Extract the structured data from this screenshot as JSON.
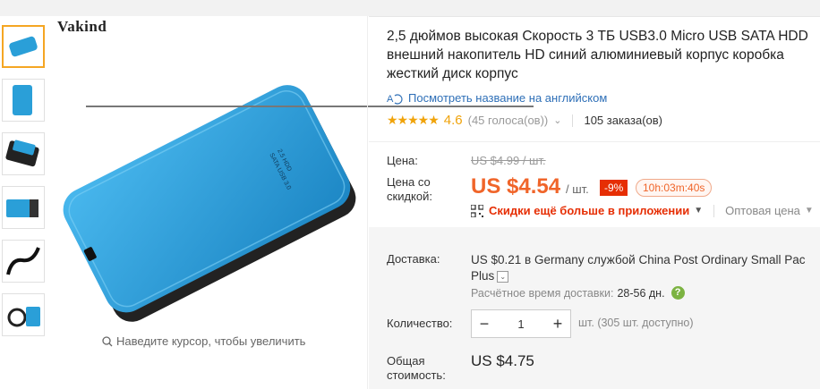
{
  "gallery": {
    "brand": "Vakind",
    "thumbs": [
      "thumb-1",
      "thumb-2",
      "thumb-3",
      "thumb-4",
      "thumb-5",
      "thumb-6"
    ],
    "zoom_hint": "Наведите курсор, чтобы увеличить",
    "accent": "#f5a623",
    "product_color": "#2a9fd8"
  },
  "product": {
    "title_line1": "2,5 дюймов высокая Скорость 3 ТБ USB3.0 Micro USB SATA HDD",
    "title_line2": "внешний накопитель HD синий алюминиевый корпус коробка",
    "title_line3": "жесткий диск корпус",
    "translate_link": "Посмотреть название на английском",
    "rating_score": "4.6",
    "votes": "(45 голоса(ов))",
    "orders": "105 заказа(ов)"
  },
  "price": {
    "label_price": "Цена:",
    "old_price": "US $4.99 / шт.",
    "label_discount_line1": "Цена со",
    "label_discount_line2": "скидкой:",
    "current": "US $4.54",
    "unit": "/ шт.",
    "discount_badge": "-9%",
    "timer": "10h:03m:40s",
    "app_offer": "Скидки ещё больше в приложении",
    "wholesale": "Оптовая цена",
    "price_color": "#f0652a",
    "badge_color": "#e62e04"
  },
  "shipping": {
    "label": "Доставка:",
    "text_line1": "US $0.21 в Germany службой China Post Ordinary Small Pac",
    "text_line2": "Plus",
    "eta_label": "Расчётное время доставки:",
    "eta_value": "28-56 дн."
  },
  "quantity": {
    "label": "Количество:",
    "value": "1",
    "minus": "−",
    "plus": "+",
    "available": "шт. (305 шт. доступно)"
  },
  "total": {
    "label_line1": "Общая",
    "label_line2": "стоимость:",
    "value": "US $4.75"
  }
}
